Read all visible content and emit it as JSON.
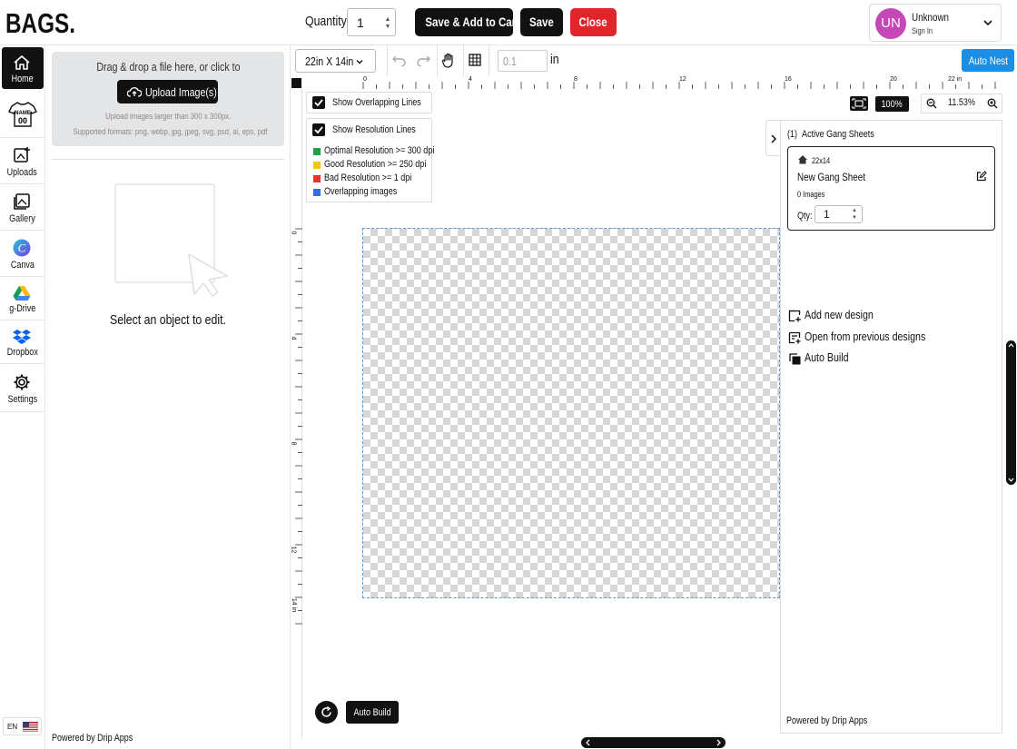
{
  "brand": {
    "logo_text": "BAGS."
  },
  "header": {
    "quantity_label": "Quantity:",
    "quantity_value": "1",
    "save_add_cart_label": "Save & Add to Cart",
    "save_label": "Save",
    "close_label": "Close",
    "user": {
      "initials": "UN",
      "name": "Unknown",
      "sign_in": "Sign In",
      "avatar_color": "#c548b6"
    }
  },
  "sidebar": {
    "items": [
      {
        "label": "Home",
        "icon": "home-icon",
        "active": true
      },
      {
        "label": "",
        "icon": "name-number-shirt-icon"
      },
      {
        "label": "Uploads",
        "icon": "upload-icon"
      },
      {
        "label": "Gallery",
        "icon": "gallery-icon"
      },
      {
        "label": "Canva",
        "icon": "canva-icon"
      },
      {
        "label": "g-Drive",
        "icon": "google-drive-icon"
      },
      {
        "label": "Dropbox",
        "icon": "dropbox-icon"
      },
      {
        "label": "Settings",
        "icon": "gear-icon"
      }
    ],
    "language": "EN"
  },
  "left_panel": {
    "dropzone_title": "Drag & drop a file here, or click to",
    "upload_button": "Upload Image(s)",
    "hint_size": "Upload images larger than 300 x 300px.",
    "hint_formats": "Supported formats: png, webp, jpg, jpeg, svg, psd, ai, eps, pdf",
    "select_object": "Select an object to edit.",
    "powered_prefix": "Powered by ",
    "powered_brand": "Drip Apps"
  },
  "toolbar": {
    "size_select": "22in X 14in",
    "increment_value": "0.1",
    "unit": "in",
    "auto_nest": "Auto Nest"
  },
  "ruler": {
    "h_labels": [
      "0",
      "4",
      "8",
      "12",
      "16",
      "20",
      "22 in"
    ],
    "v_labels": [
      "0",
      "4",
      "8",
      "12",
      "14 in"
    ]
  },
  "canvas_options": {
    "show_overlapping": "Show Overlapping Lines",
    "show_resolution": "Show Resolution Lines",
    "legend": [
      {
        "label": "Optimal Resolution >= 300 dpi",
        "color": "#22a14b"
      },
      {
        "label": "Good Resolution >= 250 dpi",
        "color": "#f2c318"
      },
      {
        "label": "Bad Resolution >= 1 dpi",
        "color": "#e3342f"
      },
      {
        "label": "Overlapping images",
        "color": "#2f6fe0"
      }
    ]
  },
  "zoom": {
    "preset": "100%",
    "value": "11.53%"
  },
  "right_panel": {
    "count": "(1)",
    "title": "Active Gang Sheets",
    "sheet": {
      "size": "22x14",
      "name": "New Gang Sheet",
      "images": "0 Images",
      "qty_label": "Qty:",
      "qty_value": "1"
    },
    "actions": [
      "Add new design",
      "Open from previous designs",
      "Auto Build"
    ],
    "powered_prefix": "Powered by ",
    "powered_brand": "Drip Apps"
  },
  "canvas_footer": {
    "auto_build": "Auto Build"
  },
  "colors": {
    "accent_blue": "#1a8fe3",
    "danger_red": "#e3242b",
    "dark": "#111111"
  }
}
